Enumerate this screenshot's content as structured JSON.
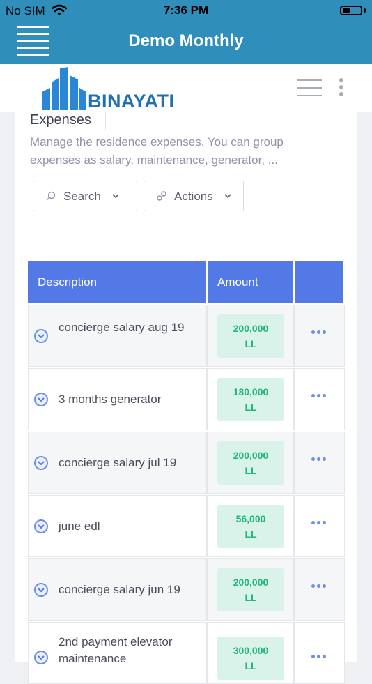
{
  "status_bar": {
    "carrier": "No SIM",
    "time": "7:36 PM"
  },
  "app_bar": {
    "title": "Demo Monthly"
  },
  "brand": {
    "logo_text": "BINAYATI"
  },
  "section": {
    "title": "Expenses",
    "description": "Manage the residence expenses. You can group expenses as salary, maintenance, generator, ..."
  },
  "toolbar": {
    "search_label": "Search",
    "actions_label": "Actions"
  },
  "table": {
    "columns": [
      "Description",
      "Amount",
      ""
    ],
    "rows": [
      {
        "description": "concierge salary aug 19",
        "amount": "200,000",
        "currency": "LL"
      },
      {
        "description": "3 months generator",
        "amount": "180,000",
        "currency": "LL"
      },
      {
        "description": "concierge salary jul 19",
        "amount": "200,000",
        "currency": "LL"
      },
      {
        "description": "june edl",
        "amount": "56,000",
        "currency": "LL"
      },
      {
        "description": "concierge salary jun 19",
        "amount": "200,000",
        "currency": "LL"
      },
      {
        "description": "2nd payment elevator maintenance",
        "amount": "300,000",
        "currency": "LL"
      }
    ]
  },
  "colors": {
    "header_blue": "#2f8fba",
    "table_header": "#5279e6",
    "amount_green": "#1fb67a"
  }
}
